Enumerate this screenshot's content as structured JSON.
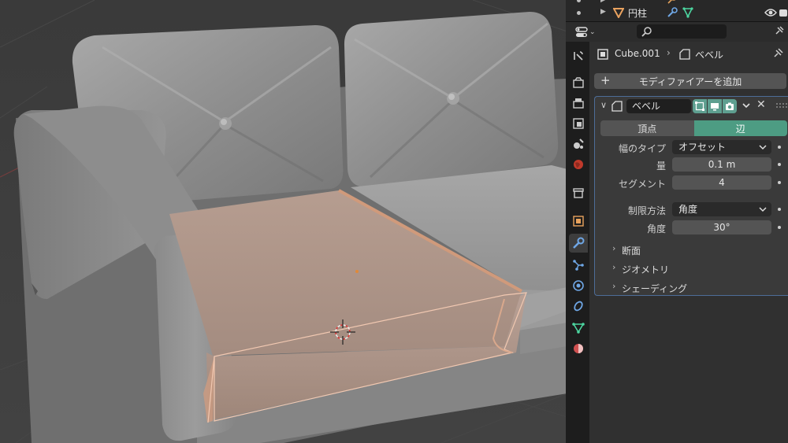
{
  "outliner": {
    "rows": [
      {
        "name": ""
      },
      {
        "name": "円柱"
      }
    ]
  },
  "header": {
    "search_placeholder": ""
  },
  "breadcrumb": {
    "object": "Cube.001",
    "modifier": "ベベル"
  },
  "add_modifier_label": "モディファイアーを追加",
  "modifier": {
    "name": "ベベル",
    "affect": {
      "vertices_label": "頂点",
      "edges_label": "辺",
      "selected": "edges"
    },
    "width_type": {
      "label": "幅のタイプ",
      "value": "オフセット"
    },
    "amount": {
      "label": "量",
      "value": "0.1 m"
    },
    "segments": {
      "label": "セグメント",
      "value": "4"
    },
    "limit_method": {
      "label": "制限方法",
      "value": "角度"
    },
    "angle": {
      "label": "角度",
      "value": "30°"
    },
    "subpanels": [
      {
        "label": "断面"
      },
      {
        "label": "ジオメトリ"
      },
      {
        "label": "シェーディング"
      }
    ]
  },
  "colors": {
    "accent_toggle": "#5e9f90",
    "selected_button": "#4d9c83",
    "selection_highlight": "#e8a57f",
    "active_border": "#4d6d98"
  },
  "tabs": [
    "tool-icon",
    "render-icon",
    "output-icon",
    "view-layer-icon",
    "scene-icon",
    "world-icon",
    "collection-icon",
    "object-icon",
    "modifier-icon",
    "particles-icon",
    "physics-icon",
    "constraints-icon",
    "data-icon",
    "material-icon"
  ]
}
